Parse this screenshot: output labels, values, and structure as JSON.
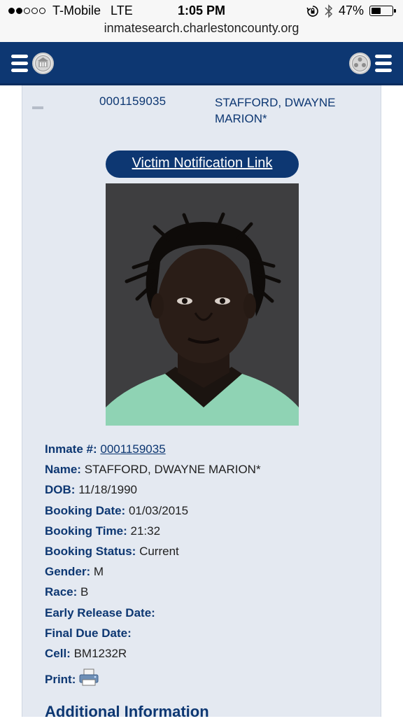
{
  "status_bar": {
    "carrier": "T-Mobile",
    "network": "LTE",
    "time": "1:05 PM",
    "battery": "47%",
    "battery_level": 0.47,
    "signal_bars": 2
  },
  "browser": {
    "url": "inmatesearch.charlestoncounty.org"
  },
  "result_row": {
    "inmate_number": "0001159035",
    "name_line1": "STAFFORD, DWAYNE",
    "name_line2": "MARION*"
  },
  "victim_link": "Victim Notification Link",
  "details": [
    {
      "label": "Inmate #:",
      "value": "0001159035",
      "link": true
    },
    {
      "label": "Name:",
      "value": "STAFFORD, DWAYNE MARION*"
    },
    {
      "label": "DOB:",
      "value": "11/18/1990"
    },
    {
      "label": "Booking Date:",
      "value": "01/03/2015"
    },
    {
      "label": "Booking Time:",
      "value": "21:32"
    },
    {
      "label": "Booking Status:",
      "value": "Current"
    },
    {
      "label": "Gender:",
      "value": "M"
    },
    {
      "label": "Race:",
      "value": "B"
    },
    {
      "label": "Early Release Date:",
      "value": ""
    },
    {
      "label": "Final Due Date:",
      "value": ""
    },
    {
      "label": "Cell:",
      "value": "BM1232R"
    }
  ],
  "print_label": "Print:",
  "additional_heading": "Additional Information",
  "colors": {
    "navy": "#0d3772",
    "panel": "#e4e9f1"
  },
  "icons": {
    "menu_left": "hamburger-icon",
    "menu_right": "hamburger-icon",
    "seal_left": "county-seal-icon",
    "seal_right": "scale-icon",
    "print": "printer-icon"
  }
}
